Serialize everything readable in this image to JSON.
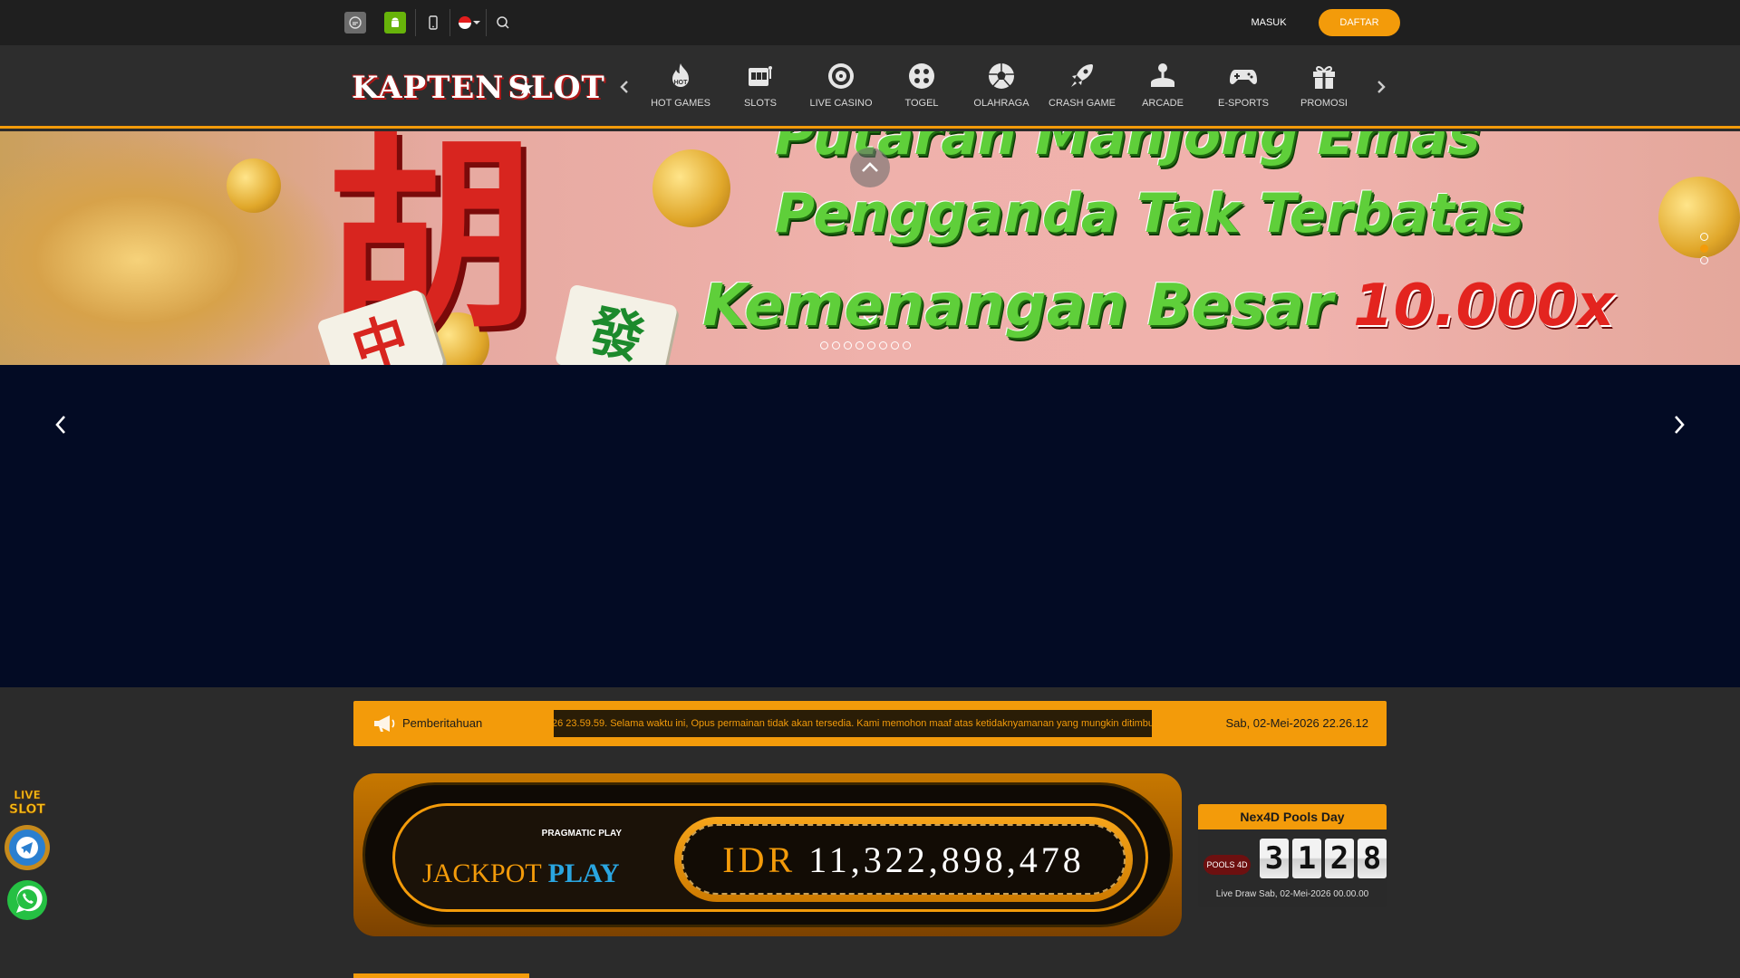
{
  "topbar": {
    "icons": [
      "chat-icon",
      "android-icon",
      "mobile-icon",
      "indonesia-flag-icon",
      "search-icon"
    ],
    "login_label": "MASUK",
    "register_label": "DAFTAR"
  },
  "brand": {
    "logo_left": "KAPTEN",
    "logo_right": "SLOT"
  },
  "nav": {
    "items": [
      {
        "label": "HOT GAMES",
        "icon": "hot-games-icon"
      },
      {
        "label": "SLOTS",
        "icon": "slots-icon"
      },
      {
        "label": "LIVE CASINO",
        "icon": "live-casino-icon"
      },
      {
        "label": "TOGEL",
        "icon": "togel-icon"
      },
      {
        "label": "OLAHRAGA",
        "icon": "soccer-ball-icon"
      },
      {
        "label": "CRASH GAME",
        "icon": "rocket-icon"
      },
      {
        "label": "ARCADE",
        "icon": "arcade-icon"
      },
      {
        "label": "E-SPORTS",
        "icon": "gamepad-icon"
      },
      {
        "label": "PROMOSI",
        "icon": "gift-icon"
      }
    ]
  },
  "banner": {
    "line1": "Putaran Mahjong Emas",
    "line2": "Pengganda Tak Terbatas",
    "line3_text": "Kemenangan Besar ",
    "line3_highlight": "10.000x",
    "char": "胡",
    "tile1": "中",
    "tile2": "發"
  },
  "notice": {
    "label": "Pemberitahuan",
    "message": "26 23.59.59. Selama waktu ini, Opus permainan tidak akan tersedia. Kami memohon maaf atas ketidaknyamanan yang mungkin ditimbulkan.",
    "datetime": "Sab, 02-Mei-2026 22.26.12"
  },
  "jackpot": {
    "provider": "PRAGMATIC PLAY",
    "title_left": "JACKPOT",
    "title_right": "PLAY",
    "currency": "IDR",
    "amount": "11,322,898,478"
  },
  "pools": {
    "title": "Nex4D Pools Day",
    "logo": "POOLS 4D",
    "digits": [
      "3",
      "1",
      "2",
      "8"
    ],
    "live_draw": "Live Draw Sab, 02-Mei-2026 00.00.00"
  },
  "floating": [
    "live-slot-icon",
    "telegram-icon",
    "whatsapp-icon"
  ],
  "colors": {
    "accent": "#f39b0a",
    "dark_bg": "#030b24",
    "topbar": "#1f1f1f"
  }
}
